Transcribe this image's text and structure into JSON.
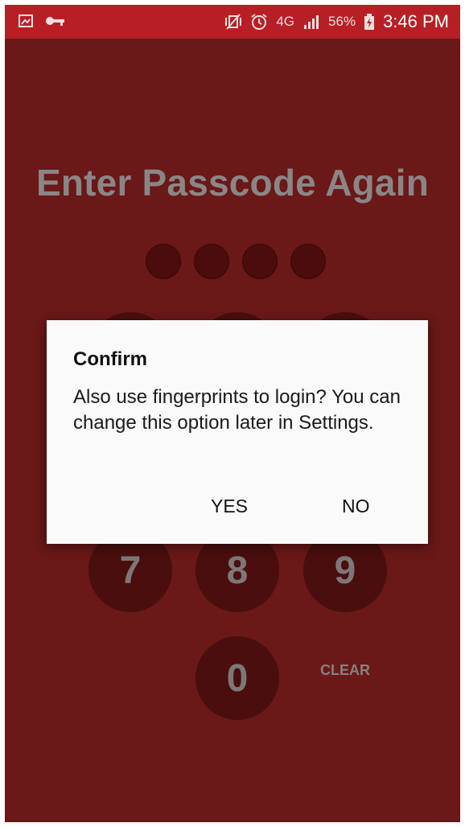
{
  "status_bar": {
    "battery_percent": "56%",
    "time": "3:46 PM",
    "network": "4G",
    "icons": [
      "gallery-icon",
      "key-icon",
      "mute-vibrate-icon",
      "alarm-icon",
      "network-4g-icon",
      "signal-icon",
      "battery-charging-icon"
    ]
  },
  "screen": {
    "title": "Enter Passcode Again",
    "passcode_dots_filled": 4,
    "keypad": {
      "visible_keys": [
        "7",
        "8",
        "9",
        "0"
      ],
      "clear_label": "CLEAR"
    }
  },
  "dialog": {
    "title": "Confirm",
    "message": "Also use fingerprints to login? You can change this option later in Settings.",
    "yes_label": "YES",
    "no_label": "NO"
  },
  "colors": {
    "status_bar": "#b81f25",
    "background": "#6a1818",
    "key_fill": "#4a0e0e",
    "dialog_bg": "#fafafa"
  }
}
